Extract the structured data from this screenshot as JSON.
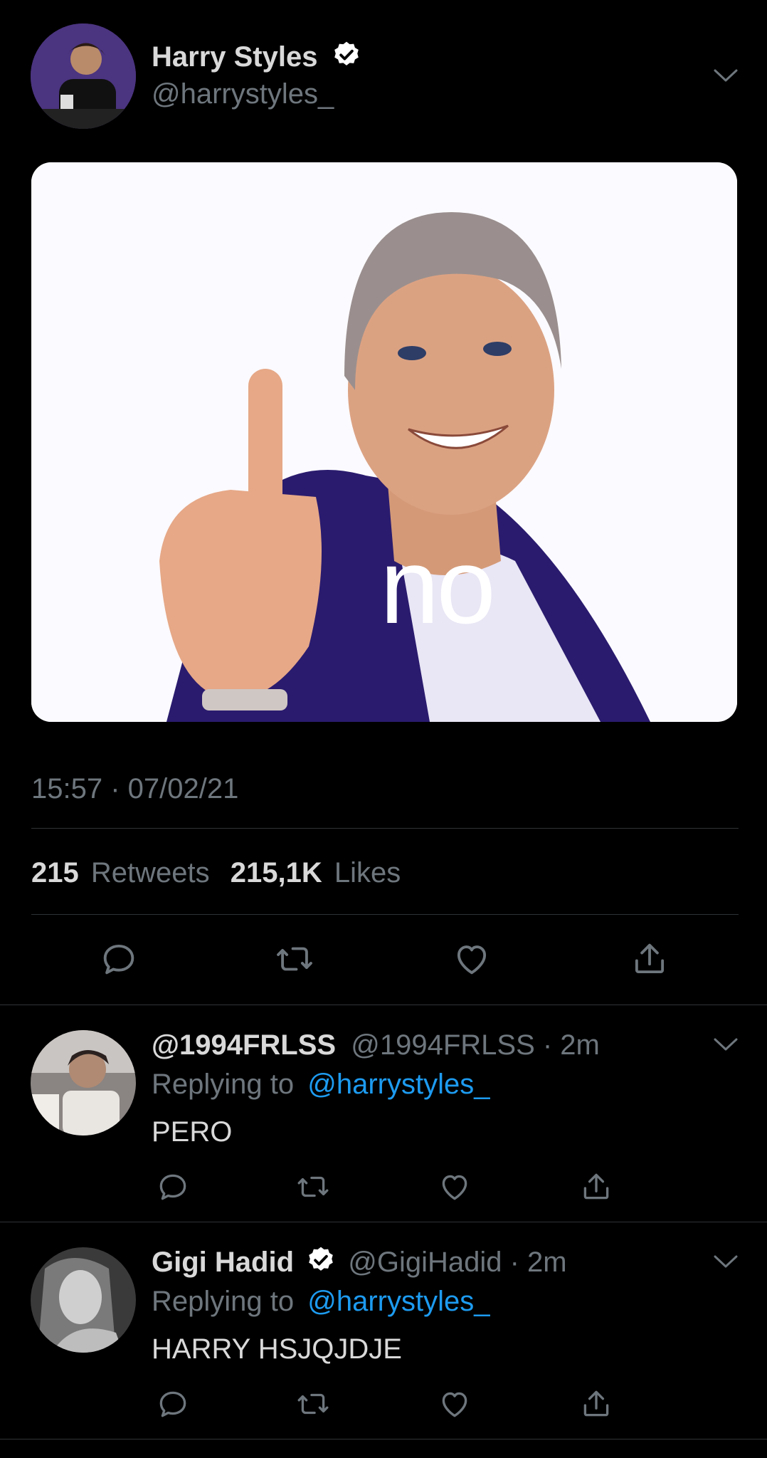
{
  "tweet": {
    "display_name": "Harry Styles",
    "handle": "@harrystyles_",
    "verified_icon": "verified-badge-icon",
    "media_text": "no",
    "timestamp": "15:57 · 07/02/21",
    "retweets_count": "215",
    "retweets_label": "Retweets",
    "likes_count": "215,1K",
    "likes_label": "Likes",
    "actions": [
      "reply-icon",
      "retweet-icon",
      "like-icon",
      "share-icon"
    ]
  },
  "replies": [
    {
      "display_name": "@1994FRLSS",
      "handle_time": "@1994FRLSS · 2m",
      "replying_prefix": "Replying to",
      "replying_to": "@harrystyles_",
      "text": "PERO",
      "verified": false
    },
    {
      "display_name": "Gigi Hadid",
      "handle_time": "@GigiHadid · 2m",
      "replying_prefix": "Replying to",
      "replying_to": "@harrystyles_",
      "text": "HARRY HSJQJDJE",
      "verified": true
    }
  ],
  "colors": {
    "background": "#000000",
    "text": "#d9d9d9",
    "muted": "#6e767d",
    "link": "#1d9bf0",
    "divider": "#2f3336"
  }
}
